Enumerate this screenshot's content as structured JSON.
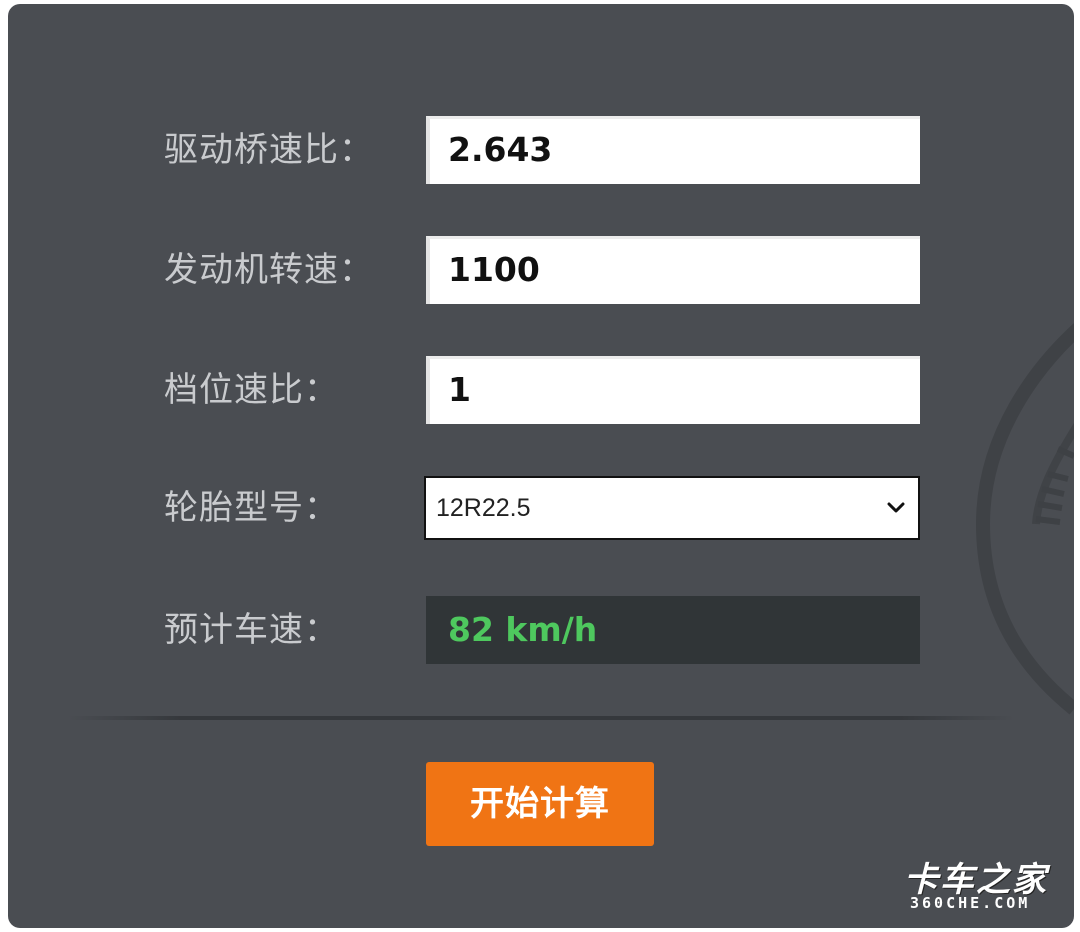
{
  "form": {
    "axle_ratio": {
      "label": "驱动桥速比：",
      "value": "2.643"
    },
    "engine_speed": {
      "label": "发动机转速：",
      "value": "1100"
    },
    "gear_ratio": {
      "label": "档位速比：",
      "value": "1"
    },
    "tire_model": {
      "label": "轮胎型号：",
      "selected": "12R22.5"
    },
    "estimated_speed": {
      "label": "预计车速：",
      "value": "82 km/h"
    }
  },
  "actions": {
    "calculate_label": "开始计算"
  },
  "watermark": {
    "main": "卡车之家",
    "sub": "360CHE.COM"
  },
  "colors": {
    "panel_bg": "#4a4d52",
    "label_text": "#c9cbce",
    "result_bg": "#303537",
    "result_text": "#4ec85e",
    "button_bg": "#f07414"
  },
  "icons": {
    "select_arrow": "chevron-down-icon"
  }
}
